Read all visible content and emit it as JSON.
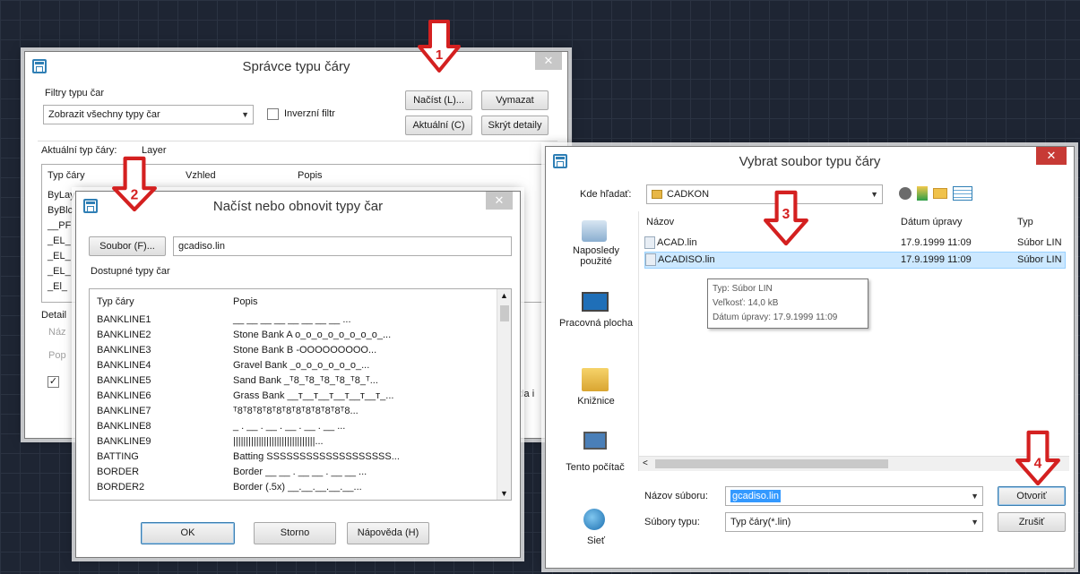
{
  "win1": {
    "title": "Správce typu čáry",
    "filters_label": "Filtry typu čar",
    "filter_value": "Zobrazit všechny typy čar",
    "invert_label": "Inverzní filtr",
    "btn_load": "Načíst (L)...",
    "btn_delete": "Vymazat",
    "btn_current": "Aktuální (C)",
    "btn_hide": "Skrýt detaily",
    "current_label": "Aktuální typ čáry:",
    "current_value": "Layer",
    "col_type": "Typ čáry",
    "col_look": "Vzhled",
    "col_desc": "Popis",
    "rows": [
      "ByLay",
      "ByBlc",
      "__PF",
      "_EL_",
      "_EL_",
      "_EL_",
      "_El_"
    ],
    "detail": "Detail",
    "det1": "Náz",
    "det2": "Pop",
    "side_text": "lda i"
  },
  "win2": {
    "title": "Načíst nebo obnovit typy čar",
    "btn_file": "Soubor (F)...",
    "file_value": "gcadiso.lin",
    "avail_label": "Dostupné typy čar",
    "col_type": "Typ čáry",
    "col_desc": "Popis",
    "rows": [
      {
        "name": "BANKLINE1",
        "desc": "__ __ __ __ __ __ __ __ ..."
      },
      {
        "name": "BANKLINE2",
        "desc": "Stone Bank A o_o_o_o_o_o_o_o_..."
      },
      {
        "name": "BANKLINE3",
        "desc": "Stone Bank B -OOOOOOOOO..."
      },
      {
        "name": "BANKLINE4",
        "desc": "Gravel Bank _o_o_o_o_o_o_..."
      },
      {
        "name": "BANKLINE5",
        "desc": "Sand Bank _ᵀ8_ᵀ8_ᵀ8_ᵀ8_ᵀ8_ᵀ..."
      },
      {
        "name": "BANKLINE6",
        "desc": "Grass Bank __ᴛ__ᴛ__ᴛ__ᴛ__ᴛ__ᴛ_..."
      },
      {
        "name": "BANKLINE7",
        "desc": "ᵀ8ᵀ8ᵀ8ᵀ8ᵀ8ᵀ8ᵀ8ᵀ8ᵀ8ᵀ8ᵀ8ᵀ8..."
      },
      {
        "name": "BANKLINE8",
        "desc": "_ . __ . __ . __ . __ . __ ..."
      },
      {
        "name": "BANKLINE9",
        "desc": "||||||||||||||||||||||||||||||||..."
      },
      {
        "name": "BATTING",
        "desc": "Batting SSSSSSSSSSSSSSSSSSS..."
      },
      {
        "name": "BORDER",
        "desc": "Border __ __ . __ __ . __ __ ..."
      },
      {
        "name": "BORDER2",
        "desc": "Border (.5x) __.__.__.__.__..."
      }
    ],
    "btn_ok": "OK",
    "btn_cancel": "Storno",
    "btn_help": "Nápověda (H)"
  },
  "win3": {
    "title": "Vybrat soubor typu čáry",
    "lookin_label": "Kde hľadať:",
    "lookin_value": "CADKON",
    "col_name": "Názov",
    "col_date": "Dátum úpravy",
    "col_type": "Typ",
    "files": [
      {
        "name": "ACAD.lin",
        "date": "17.9.1999 11:09",
        "type": "Súbor LIN"
      },
      {
        "name": "ACADISO.lin",
        "date": "17.9.1999 11:09",
        "type": "Súbor LIN"
      }
    ],
    "tooltip": [
      "Typ: Súbor LIN",
      "Veľkosť: 14,0 kB",
      "Dátum úpravy: 17.9.1999 11:09"
    ],
    "places": [
      "Naposledy použité",
      "Pracovná plocha",
      "Knižnice",
      "Tento počítač",
      "Sieť"
    ],
    "filename_label": "Názov súboru:",
    "filename_value": "gcadiso.lin",
    "filetype_label": "Súbory typu:",
    "filetype_value": "Typ čáry(*.lin)",
    "btn_open": "Otvoriť",
    "btn_cancel": "Zrušiť"
  },
  "arrows": [
    "1",
    "2",
    "3",
    "4"
  ],
  "colors": {
    "arrow": "#d42020",
    "selection": "#cce8ff",
    "accent": "#2f7fb5"
  }
}
